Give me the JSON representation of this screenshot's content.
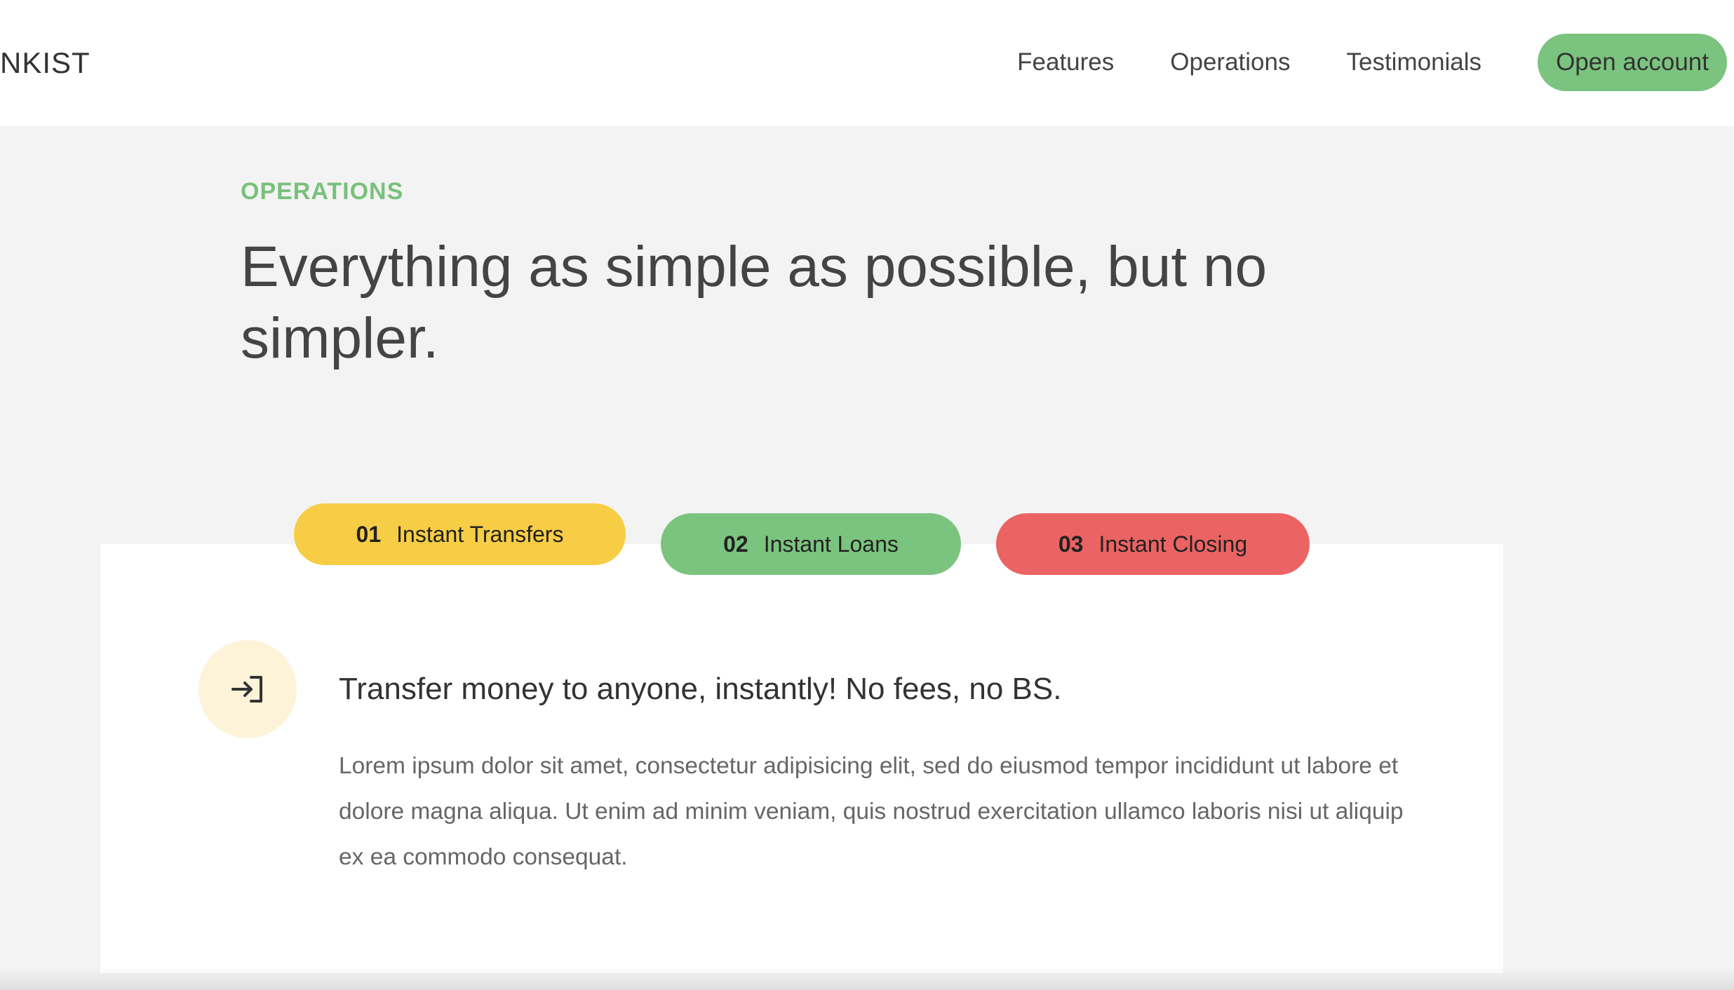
{
  "nav": {
    "logo_text": "NKIST",
    "links": [
      "Features",
      "Operations",
      "Testimonials"
    ],
    "cta_label": "Open account"
  },
  "section": {
    "tag": "OPERATIONS",
    "title": "Everything as simple as possible, but no simpler."
  },
  "tabs": [
    {
      "num": "01",
      "label": "Instant Transfers",
      "color": "#f6cd45"
    },
    {
      "num": "02",
      "label": "Instant Loans",
      "color": "#7bc47f"
    },
    {
      "num": "03",
      "label": "Instant Closing",
      "color": "#ec6363"
    }
  ],
  "content": {
    "icon": "log-in-icon",
    "title": "Transfer money to anyone, instantly! No fees, no BS.",
    "body": "Lorem ipsum dolor sit amet, consectetur adipisicing elit, sed do eiusmod tempor incididunt ut labore et dolore magna aliqua. Ut enim ad minim veniam, quis nostrud exercitation ullamco laboris nisi ut aliquip ex ea commodo consequat."
  },
  "colors": {
    "accent_green": "#7bc47f",
    "accent_yellow": "#f6cd45",
    "accent_red": "#ec6363",
    "page_bg": "#f3f3f3"
  }
}
